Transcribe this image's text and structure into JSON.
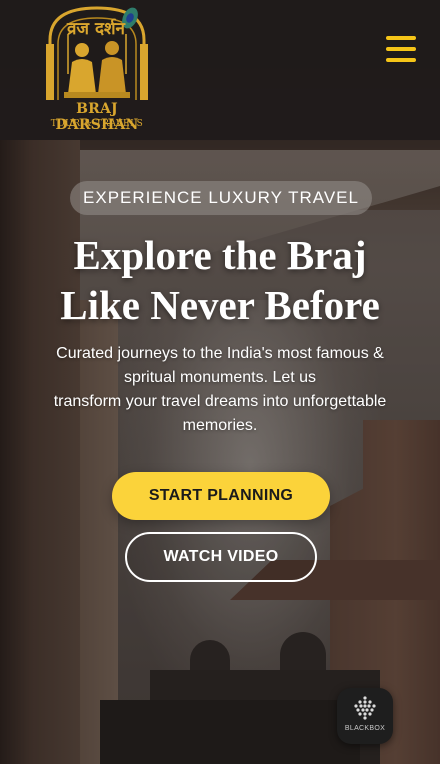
{
  "header": {
    "logo": {
      "hindi_text": "व्रज दर्शन",
      "name": "BRAJ DARSHAN",
      "tagline": "TOUR & TRAVELS"
    },
    "menu_icon": "hamburger-menu-icon"
  },
  "hero": {
    "badge": "EXPERIENCE LUXURY TRAVEL",
    "headline_line1": "Explore the Braj",
    "headline_line2": "Like Never Before",
    "subtext_line1": "Curated journeys to the India's most famous &",
    "subtext_line2": "spritual monuments. Let us",
    "subtext_line3": "transform your travel dreams into unforgettable",
    "subtext_line4": "memories.",
    "primary_button": "START PLANNING",
    "secondary_button": "WATCH VIDEO"
  },
  "widget": {
    "label": "BLACKBOX"
  },
  "colors": {
    "accent": "#fbd33a",
    "logo_gold": "#d9a62e",
    "header_bg": "#1c1818"
  }
}
